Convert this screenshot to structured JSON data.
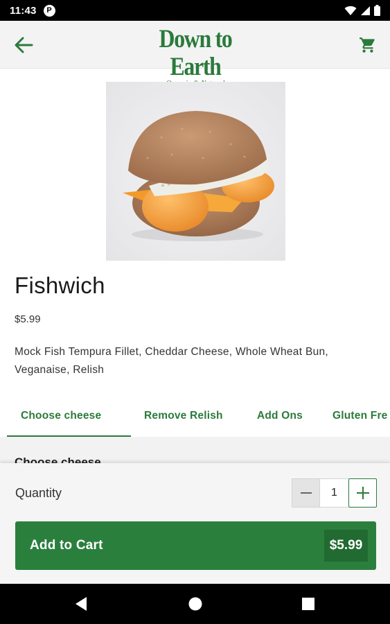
{
  "status_bar": {
    "time": "11:43",
    "app_icon": "pandora-p-icon",
    "icons": [
      "wifi-icon",
      "cellular-signal-icon",
      "battery-icon"
    ]
  },
  "header": {
    "back_icon": "arrow-left-icon",
    "logo_text": "Down to Earth",
    "logo_tagline": "Organic & Natural",
    "cart_icon": "shopping-cart-icon",
    "brand_color": "#2b7a3b"
  },
  "product": {
    "image_subject": "fishwich-sandwich",
    "title": "Fishwich",
    "price": "$5.99",
    "description": "Mock Fish Tempura Fillet, Cheddar Cheese, Whole Wheat Bun, Veganaise, Relish"
  },
  "tabs": [
    {
      "label": "Choose cheese",
      "active": true
    },
    {
      "label": "Remove Relish",
      "active": false
    },
    {
      "label": "Add Ons",
      "active": false
    },
    {
      "label": "Gluten Fre",
      "active": false
    }
  ],
  "section": {
    "heading": "Choose cheese"
  },
  "order": {
    "quantity_label": "Quantity",
    "quantity_value": "1",
    "minus_icon": "minus-icon",
    "plus_icon": "plus-icon",
    "add_button_label": "Add to Cart",
    "add_button_price": "$5.99",
    "button_color": "#2b7f3d"
  },
  "nav_bar": {
    "icons": [
      "back-triangle-icon",
      "home-circle-icon",
      "recents-square-icon"
    ]
  }
}
